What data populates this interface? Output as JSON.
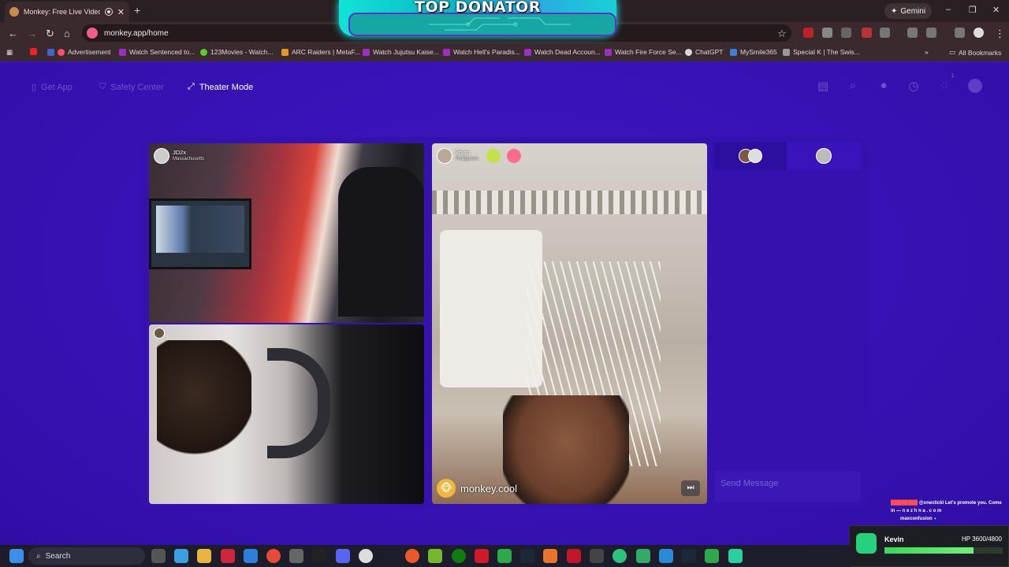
{
  "browser": {
    "tab_title": "Monkey: Free Live Video Ch",
    "tab_close": "✕",
    "new_tab": "+",
    "gemini_label": "Gemini",
    "url": "monkey.app/home",
    "window_controls": {
      "minimize": "–",
      "restore": "❐",
      "close": "✕"
    }
  },
  "overlay": {
    "top_donator": "TOP DONATOR"
  },
  "bookmarks": [
    {
      "label": "Advertisement",
      "color": "#ff4d6d"
    },
    {
      "label": "Watch Sentenced to...",
      "color": "#9b2fc4"
    },
    {
      "label": "123Movies - Watch...",
      "color": "#5cc93a"
    },
    {
      "label": "ARC Raiders | MetaF...",
      "color": "#e09a2a"
    },
    {
      "label": "Watch Jujutsu Kaise...",
      "color": "#9b2fc4"
    },
    {
      "label": "Watch Hell's Paradis...",
      "color": "#9b2fc4"
    },
    {
      "label": "Watch Dead Accoun...",
      "color": "#9b2fc4"
    },
    {
      "label": "Watch Fire Force Se...",
      "color": "#9b2fc4"
    },
    {
      "label": "ChatGPT",
      "color": "#d9d9d9"
    },
    {
      "label": "MySmile365",
      "color": "#3d7de0"
    },
    {
      "label": "Special K | The Swis...",
      "color": "#999999"
    }
  ],
  "bookmarks_more": "»",
  "all_bookmarks": "All Bookmarks",
  "app": {
    "nav": {
      "get_app": "Get App",
      "safety_center": "Safety Center",
      "theater_mode": "Theater Mode"
    },
    "notification_count": "1",
    "videos": {
      "top_left": {
        "name": "JD2x",
        "location": "Massachusetts"
      },
      "right": {
        "name": "khian",
        "location": "Philippines",
        "watermark": "monkey.cool"
      }
    },
    "send_message_placeholder": "Send Message"
  },
  "stream_chat": {
    "line1_user": "@oneclickl",
    "line1_text": "Let's promote you. Come in — n e z h n a . c o m",
    "line2_user": "maxconfusion"
  },
  "hp_widget": {
    "name": "Kevin",
    "hp_text": "HP 3600/4800",
    "hp_fraction": 0.75
  },
  "taskbar": {
    "search_label": "Search"
  }
}
